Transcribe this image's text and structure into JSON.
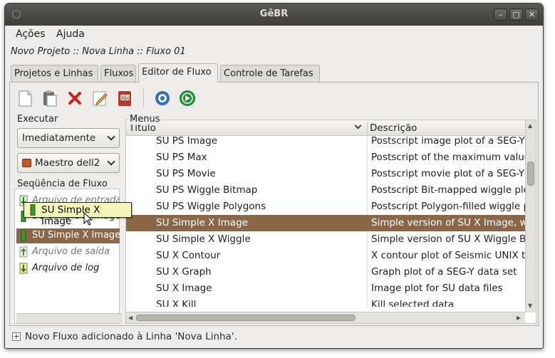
{
  "window": {
    "title": "GêBR"
  },
  "menubar": [
    "Ações",
    "Ajuda"
  ],
  "breadcrumb": "Novo Projeto :: Nova Linha :: Fluxo 01",
  "tabs": [
    "Projetos e Linhas",
    "Fluxos",
    "Editor de Fluxo",
    "Controle de Tarefas"
  ],
  "active_tab": "Editor de Fluxo",
  "toolbar_icons": [
    "new-program-icon",
    "paste-icon",
    "delete-icon",
    "edit-icon",
    "help-icon",
    "configure-icon",
    "run-icon"
  ],
  "left": {
    "execute_label": "Executar",
    "execute_mode": "Imediatamente",
    "maestro": "Maestro dell2",
    "sequence_label": "Seqüência de Fluxo",
    "flow_items": [
      {
        "label": "Arquivo de entrada",
        "style": "italic"
      },
      {
        "label": "SU Simple X Image",
        "style": "normal"
      },
      {
        "label": "SU Simple X Image",
        "style": "selected"
      },
      {
        "label": "Arquivo de saída",
        "style": "italic"
      },
      {
        "label": "Arquivo de log",
        "style": "normal"
      }
    ]
  },
  "tooltip": "SU Simple X Image",
  "menus": {
    "label": "Menus",
    "columns": [
      "Título",
      "Descrição"
    ],
    "rows": [
      {
        "title": "SU PS Image",
        "desc": "Postscript image plot of a SEG-Y"
      },
      {
        "title": "SU PS Max",
        "desc": "Postscript of the maximum value"
      },
      {
        "title": "SU PS Movie",
        "desc": "Postscript movie plot of a SEG-Y"
      },
      {
        "title": "SU PS Wiggle Bitmap",
        "desc": "Postscript Bit-mapped wiggle plo"
      },
      {
        "title": "SU PS Wiggle Polygons",
        "desc": "Postscript Polygon-filled wiggle p"
      },
      {
        "title": "SU Simple X Image",
        "desc": "Simple version of SU X Image, wit"
      },
      {
        "title": "SU Simple X Wiggle",
        "desc": "Simple version of SU X Wiggle Bit"
      },
      {
        "title": "SU X Contour",
        "desc": "X contour plot of Seismic UNIX tr"
      },
      {
        "title": "SU X Graph",
        "desc": "Graph plot of a SEG-Y data set"
      },
      {
        "title": "SU X Image",
        "desc": "Image plot for SU data files"
      },
      {
        "title": "SU X Kill",
        "desc": "Kill selected data"
      }
    ],
    "selected_index": 5
  },
  "status": "Novo Fluxo adicionado à Linha 'Nova Linha'.",
  "colors": {
    "selection": "#8b6749",
    "titlebar": "#3f3e3a",
    "tooltip": "#f5f5b5"
  }
}
